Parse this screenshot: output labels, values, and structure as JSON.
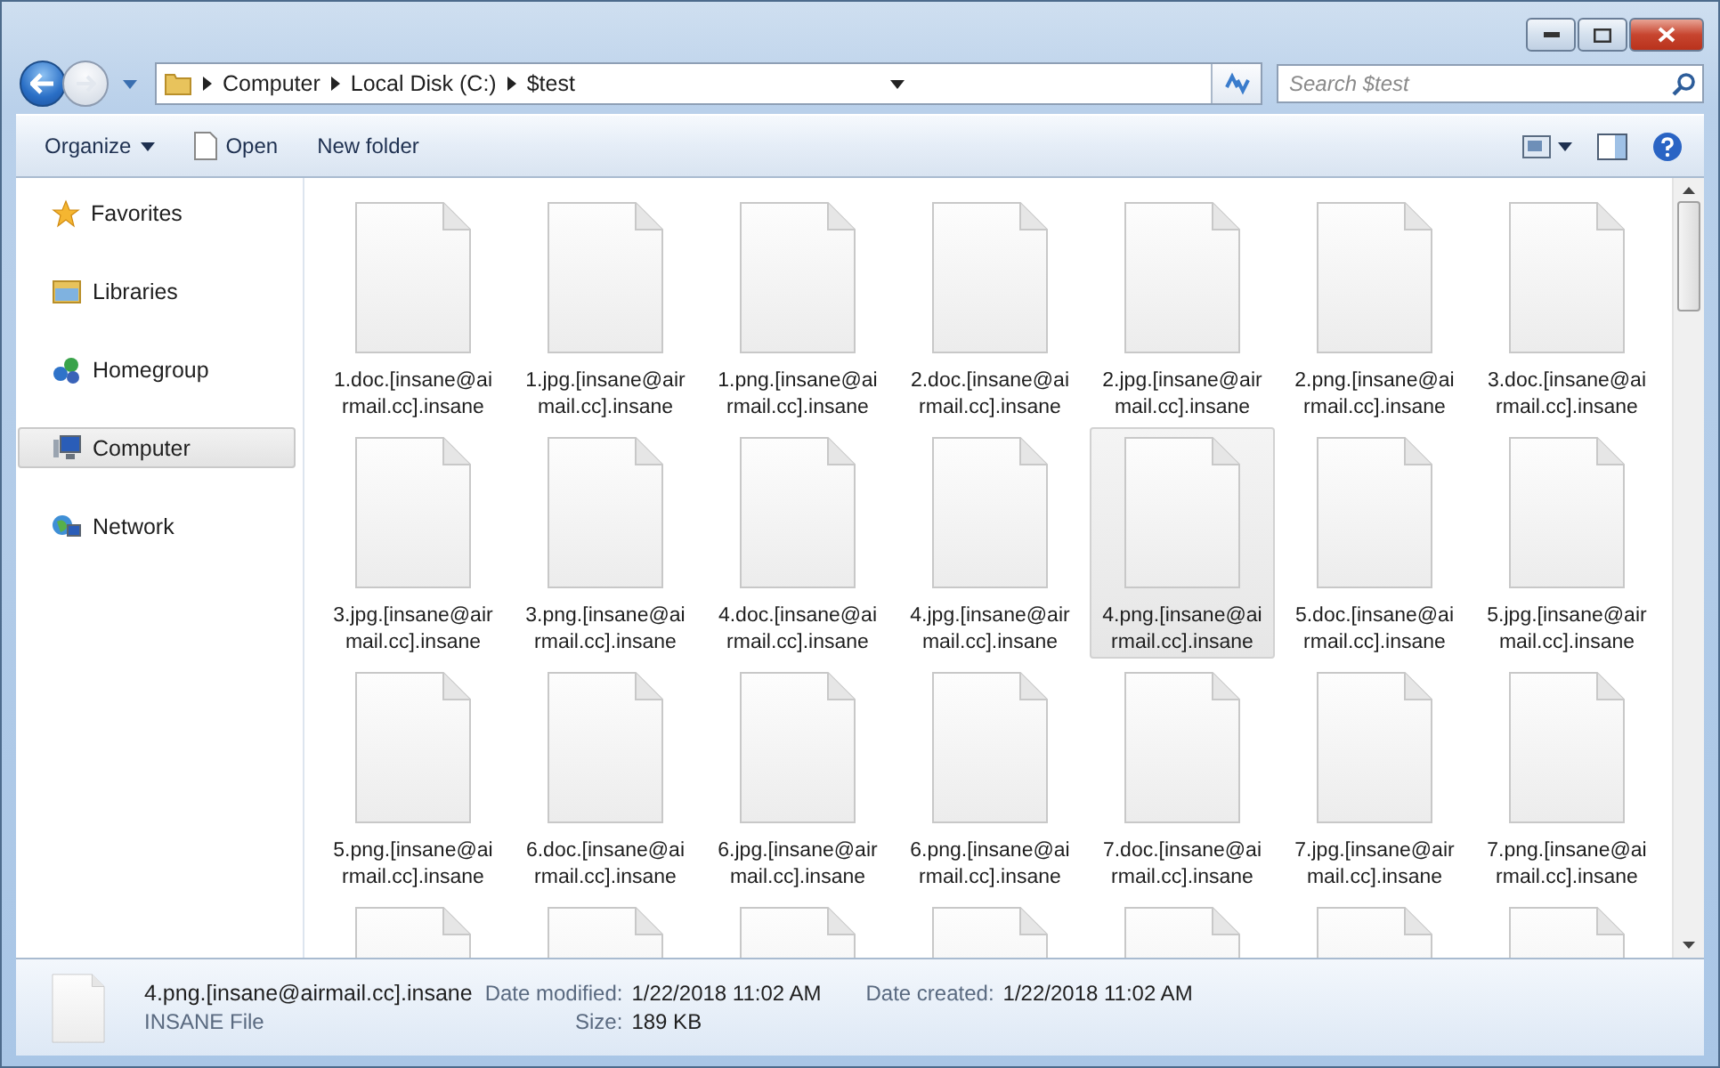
{
  "address_bar": {
    "breadcrumbs": [
      "Computer",
      "Local Disk (C:)",
      "$test"
    ]
  },
  "search": {
    "placeholder": "Search $test"
  },
  "toolbar": {
    "buttons": [
      {
        "label": "Organize",
        "kind": "menu"
      },
      {
        "label": "Open",
        "kind": "open"
      },
      {
        "label": "New folder",
        "kind": "plain"
      }
    ]
  },
  "sidebar": {
    "items": [
      {
        "label": "Favorites",
        "kind": "favorites",
        "selected": false
      },
      {
        "label": "Libraries",
        "kind": "libraries",
        "selected": false
      },
      {
        "label": "Homegroup",
        "kind": "homegroup",
        "selected": false
      },
      {
        "label": "Computer",
        "kind": "computer",
        "selected": true
      },
      {
        "label": "Network",
        "kind": "network",
        "selected": false
      }
    ]
  },
  "files": [
    {
      "name_lines": [
        "1.doc.[insane@ai",
        "rmail.cc].insane"
      ],
      "selected": false
    },
    {
      "name_lines": [
        "1.jpg.[insane@air",
        "mail.cc].insane"
      ],
      "selected": false
    },
    {
      "name_lines": [
        "1.png.[insane@ai",
        "rmail.cc].insane"
      ],
      "selected": false
    },
    {
      "name_lines": [
        "2.doc.[insane@ai",
        "rmail.cc].insane"
      ],
      "selected": false
    },
    {
      "name_lines": [
        "2.jpg.[insane@air",
        "mail.cc].insane"
      ],
      "selected": false
    },
    {
      "name_lines": [
        "2.png.[insane@ai",
        "rmail.cc].insane"
      ],
      "selected": false
    },
    {
      "name_lines": [
        "3.doc.[insane@ai",
        "rmail.cc].insane"
      ],
      "selected": false
    },
    {
      "name_lines": [
        "3.jpg.[insane@air",
        "mail.cc].insane"
      ],
      "selected": false
    },
    {
      "name_lines": [
        "3.png.[insane@ai",
        "rmail.cc].insane"
      ],
      "selected": false
    },
    {
      "name_lines": [
        "4.doc.[insane@ai",
        "rmail.cc].insane"
      ],
      "selected": false
    },
    {
      "name_lines": [
        "4.jpg.[insane@air",
        "mail.cc].insane"
      ],
      "selected": false
    },
    {
      "name_lines": [
        "4.png.[insane@ai",
        "rmail.cc].insane"
      ],
      "selected": true
    },
    {
      "name_lines": [
        "5.doc.[insane@ai",
        "rmail.cc].insane"
      ],
      "selected": false
    },
    {
      "name_lines": [
        "5.jpg.[insane@air",
        "mail.cc].insane"
      ],
      "selected": false
    },
    {
      "name_lines": [
        "5.png.[insane@ai",
        "rmail.cc].insane"
      ],
      "selected": false
    },
    {
      "name_lines": [
        "6.doc.[insane@ai",
        "rmail.cc].insane"
      ],
      "selected": false
    },
    {
      "name_lines": [
        "6.jpg.[insane@air",
        "mail.cc].insane"
      ],
      "selected": false
    },
    {
      "name_lines": [
        "6.png.[insane@ai",
        "rmail.cc].insane"
      ],
      "selected": false
    },
    {
      "name_lines": [
        "7.doc.[insane@ai",
        "rmail.cc].insane"
      ],
      "selected": false
    },
    {
      "name_lines": [
        "7.jpg.[insane@air",
        "mail.cc].insane"
      ],
      "selected": false
    },
    {
      "name_lines": [
        "7.png.[insane@ai",
        "rmail.cc].insane"
      ],
      "selected": false
    },
    {
      "kind": "cut_off"
    },
    {
      "kind": "cut_off"
    },
    {
      "kind": "cut_off"
    },
    {
      "kind": "cut_off"
    },
    {
      "kind": "cut_off"
    },
    {
      "kind": "cut_off"
    },
    {
      "kind": "cut_off"
    }
  ],
  "details": {
    "name": "4.png.[insane@airmail.cc].insane",
    "type": "INSANE File",
    "fields": [
      {
        "label": "Date modified:",
        "value": "1/22/2018 11:02 AM"
      },
      {
        "label": "Size:",
        "value": "189 KB"
      },
      {
        "label": "Date created:",
        "value": "1/22/2018 11:02 AM"
      }
    ]
  }
}
